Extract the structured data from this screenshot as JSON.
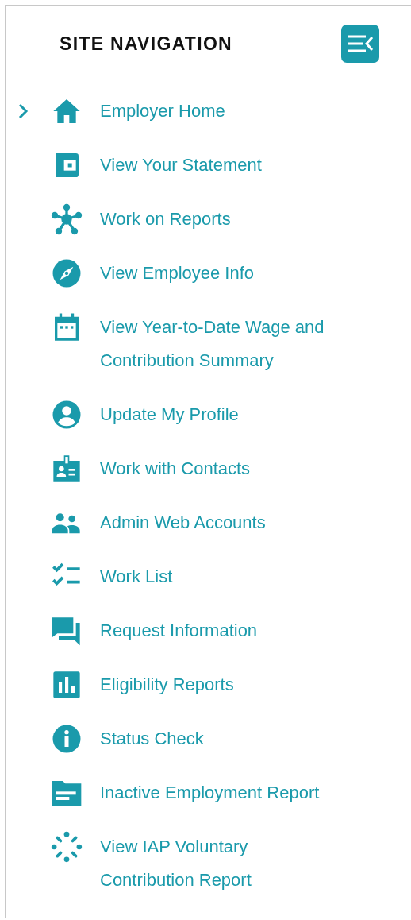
{
  "heading": "SITE NAVIGATION",
  "items": [
    {
      "label": "Employer Home",
      "selected": true
    },
    {
      "label": "View Your Statement",
      "selected": false
    },
    {
      "label": "Work on Reports",
      "selected": false
    },
    {
      "label": "View Employee Info",
      "selected": false
    },
    {
      "label": "View Year-to-Date Wage and Contribution Summary",
      "selected": false
    },
    {
      "label": "Update My Profile",
      "selected": false
    },
    {
      "label": "Work with Contacts",
      "selected": false
    },
    {
      "label": "Admin Web Accounts",
      "selected": false
    },
    {
      "label": "Work List",
      "selected": false
    },
    {
      "label": "Request Information",
      "selected": false
    },
    {
      "label": "Eligibility Reports",
      "selected": false
    },
    {
      "label": "Status Check",
      "selected": false
    },
    {
      "label": "Inactive Employment Report",
      "selected": false
    },
    {
      "label": "View IAP Voluntary Contribution Report",
      "selected": false
    }
  ]
}
